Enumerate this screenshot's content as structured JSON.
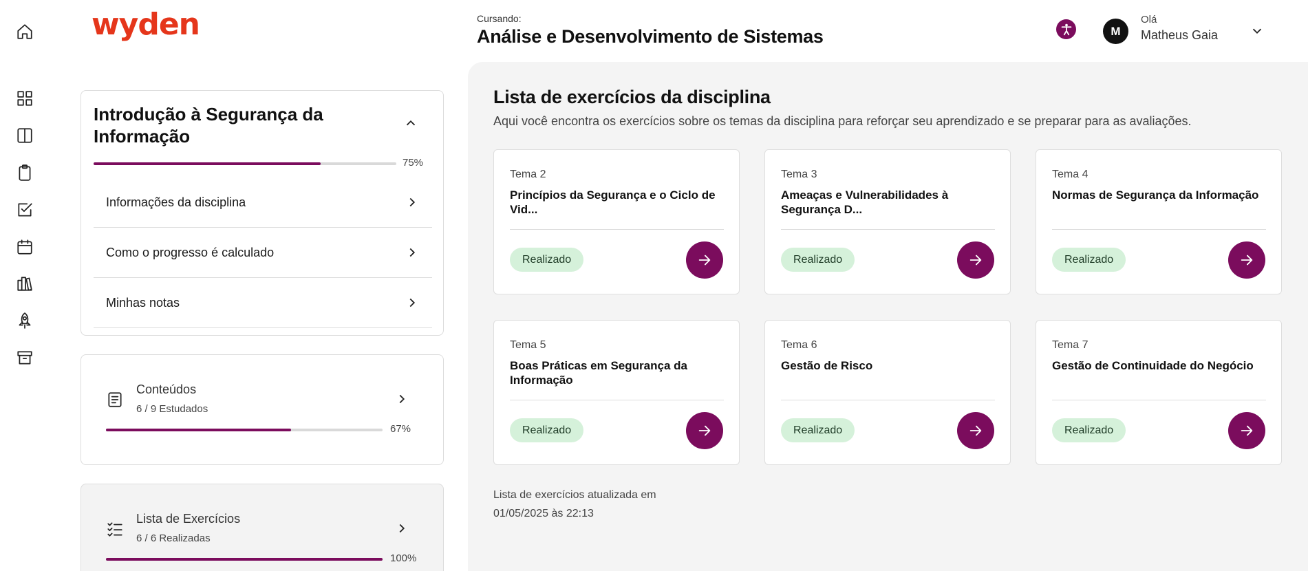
{
  "brand": {
    "logo_text": "wyden",
    "accent": "#7b0c5d",
    "logo_color": "#e5361b",
    "success_bg": "#d5f1da"
  },
  "rail": {
    "items": [
      {
        "icon": "home-icon"
      },
      {
        "icon": "dashboard-icon"
      },
      {
        "icon": "book-icon"
      },
      {
        "icon": "clipboard-icon"
      },
      {
        "icon": "checkbox-icon"
      },
      {
        "icon": "calendar-icon"
      },
      {
        "icon": "library-icon"
      },
      {
        "icon": "rocket-icon"
      },
      {
        "icon": "archive-icon"
      }
    ]
  },
  "header": {
    "caption": "Cursando:",
    "course": "Análise e Desenvolvimento de Sistemas",
    "greeting": "Olá",
    "user_name": "Matheus Gaia",
    "avatar_letter": "M"
  },
  "discipline": {
    "title": "Introdução à Segurança da Informação",
    "progress": 0.75,
    "progress_label": "75%",
    "menu": [
      {
        "label": "Informações da disciplina"
      },
      {
        "label": "Como o progresso é calculado"
      },
      {
        "label": "Minhas notas"
      }
    ]
  },
  "contents": {
    "title": "Conteúdos",
    "subtitle": "6 / 9 Estudados",
    "progress": 0.67,
    "progress_label": "67%"
  },
  "exercises_panel": {
    "title": "Lista de Exercícios",
    "subtitle": "6 / 6 Realizadas",
    "progress": 1.0,
    "progress_label": "100%"
  },
  "main": {
    "title": "Lista de exercícios da disciplina",
    "subtitle": "Aqui você encontra os exercícios sobre os temas da disciplina para reforçar seu aprendizado e se preparar para as avaliações.",
    "cards": [
      {
        "tema": "Tema 2",
        "title": "Princípios da Segurança e o Ciclo de Vid...",
        "status": "Realizado"
      },
      {
        "tema": "Tema 3",
        "title": "Ameaças e Vulnerabilidades à Segurança D...",
        "status": "Realizado"
      },
      {
        "tema": "Tema 4",
        "title": "Normas de Segurança da Informação",
        "status": "Realizado"
      },
      {
        "tema": "Tema 5",
        "title": "Boas Práticas em Segurança da Informação",
        "status": "Realizado"
      },
      {
        "tema": "Tema 6",
        "title": "Gestão de Risco",
        "status": "Realizado"
      },
      {
        "tema": "Tema 7",
        "title": "Gestão de Continuidade do Negócio",
        "status": "Realizado"
      }
    ],
    "updated_line1": "Lista de exercícios atualizada em",
    "updated_line2": "01/05/2025 às 22:13"
  }
}
